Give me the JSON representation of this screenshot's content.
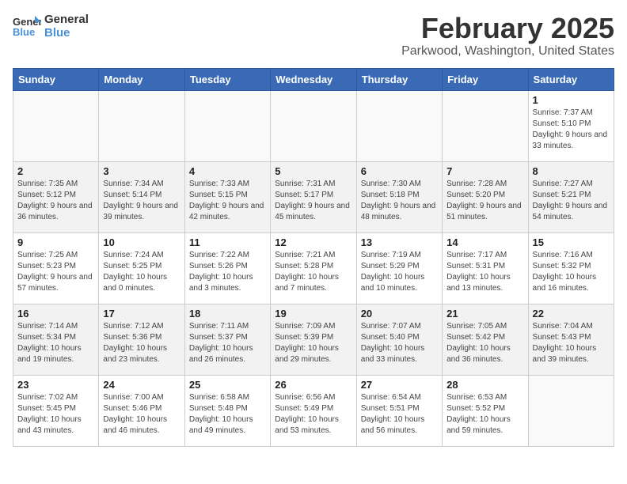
{
  "header": {
    "logo_line1": "General",
    "logo_line2": "Blue",
    "month": "February 2025",
    "location": "Parkwood, Washington, United States"
  },
  "weekdays": [
    "Sunday",
    "Monday",
    "Tuesday",
    "Wednesday",
    "Thursday",
    "Friday",
    "Saturday"
  ],
  "weeks": [
    [
      {
        "day": "",
        "info": ""
      },
      {
        "day": "",
        "info": ""
      },
      {
        "day": "",
        "info": ""
      },
      {
        "day": "",
        "info": ""
      },
      {
        "day": "",
        "info": ""
      },
      {
        "day": "",
        "info": ""
      },
      {
        "day": "1",
        "info": "Sunrise: 7:37 AM\nSunset: 5:10 PM\nDaylight: 9 hours and 33 minutes."
      }
    ],
    [
      {
        "day": "2",
        "info": "Sunrise: 7:35 AM\nSunset: 5:12 PM\nDaylight: 9 hours and 36 minutes."
      },
      {
        "day": "3",
        "info": "Sunrise: 7:34 AM\nSunset: 5:14 PM\nDaylight: 9 hours and 39 minutes."
      },
      {
        "day": "4",
        "info": "Sunrise: 7:33 AM\nSunset: 5:15 PM\nDaylight: 9 hours and 42 minutes."
      },
      {
        "day": "5",
        "info": "Sunrise: 7:31 AM\nSunset: 5:17 PM\nDaylight: 9 hours and 45 minutes."
      },
      {
        "day": "6",
        "info": "Sunrise: 7:30 AM\nSunset: 5:18 PM\nDaylight: 9 hours and 48 minutes."
      },
      {
        "day": "7",
        "info": "Sunrise: 7:28 AM\nSunset: 5:20 PM\nDaylight: 9 hours and 51 minutes."
      },
      {
        "day": "8",
        "info": "Sunrise: 7:27 AM\nSunset: 5:21 PM\nDaylight: 9 hours and 54 minutes."
      }
    ],
    [
      {
        "day": "9",
        "info": "Sunrise: 7:25 AM\nSunset: 5:23 PM\nDaylight: 9 hours and 57 minutes."
      },
      {
        "day": "10",
        "info": "Sunrise: 7:24 AM\nSunset: 5:25 PM\nDaylight: 10 hours and 0 minutes."
      },
      {
        "day": "11",
        "info": "Sunrise: 7:22 AM\nSunset: 5:26 PM\nDaylight: 10 hours and 3 minutes."
      },
      {
        "day": "12",
        "info": "Sunrise: 7:21 AM\nSunset: 5:28 PM\nDaylight: 10 hours and 7 minutes."
      },
      {
        "day": "13",
        "info": "Sunrise: 7:19 AM\nSunset: 5:29 PM\nDaylight: 10 hours and 10 minutes."
      },
      {
        "day": "14",
        "info": "Sunrise: 7:17 AM\nSunset: 5:31 PM\nDaylight: 10 hours and 13 minutes."
      },
      {
        "day": "15",
        "info": "Sunrise: 7:16 AM\nSunset: 5:32 PM\nDaylight: 10 hours and 16 minutes."
      }
    ],
    [
      {
        "day": "16",
        "info": "Sunrise: 7:14 AM\nSunset: 5:34 PM\nDaylight: 10 hours and 19 minutes."
      },
      {
        "day": "17",
        "info": "Sunrise: 7:12 AM\nSunset: 5:36 PM\nDaylight: 10 hours and 23 minutes."
      },
      {
        "day": "18",
        "info": "Sunrise: 7:11 AM\nSunset: 5:37 PM\nDaylight: 10 hours and 26 minutes."
      },
      {
        "day": "19",
        "info": "Sunrise: 7:09 AM\nSunset: 5:39 PM\nDaylight: 10 hours and 29 minutes."
      },
      {
        "day": "20",
        "info": "Sunrise: 7:07 AM\nSunset: 5:40 PM\nDaylight: 10 hours and 33 minutes."
      },
      {
        "day": "21",
        "info": "Sunrise: 7:05 AM\nSunset: 5:42 PM\nDaylight: 10 hours and 36 minutes."
      },
      {
        "day": "22",
        "info": "Sunrise: 7:04 AM\nSunset: 5:43 PM\nDaylight: 10 hours and 39 minutes."
      }
    ],
    [
      {
        "day": "23",
        "info": "Sunrise: 7:02 AM\nSunset: 5:45 PM\nDaylight: 10 hours and 43 minutes."
      },
      {
        "day": "24",
        "info": "Sunrise: 7:00 AM\nSunset: 5:46 PM\nDaylight: 10 hours and 46 minutes."
      },
      {
        "day": "25",
        "info": "Sunrise: 6:58 AM\nSunset: 5:48 PM\nDaylight: 10 hours and 49 minutes."
      },
      {
        "day": "26",
        "info": "Sunrise: 6:56 AM\nSunset: 5:49 PM\nDaylight: 10 hours and 53 minutes."
      },
      {
        "day": "27",
        "info": "Sunrise: 6:54 AM\nSunset: 5:51 PM\nDaylight: 10 hours and 56 minutes."
      },
      {
        "day": "28",
        "info": "Sunrise: 6:53 AM\nSunset: 5:52 PM\nDaylight: 10 hours and 59 minutes."
      },
      {
        "day": "",
        "info": ""
      }
    ]
  ]
}
